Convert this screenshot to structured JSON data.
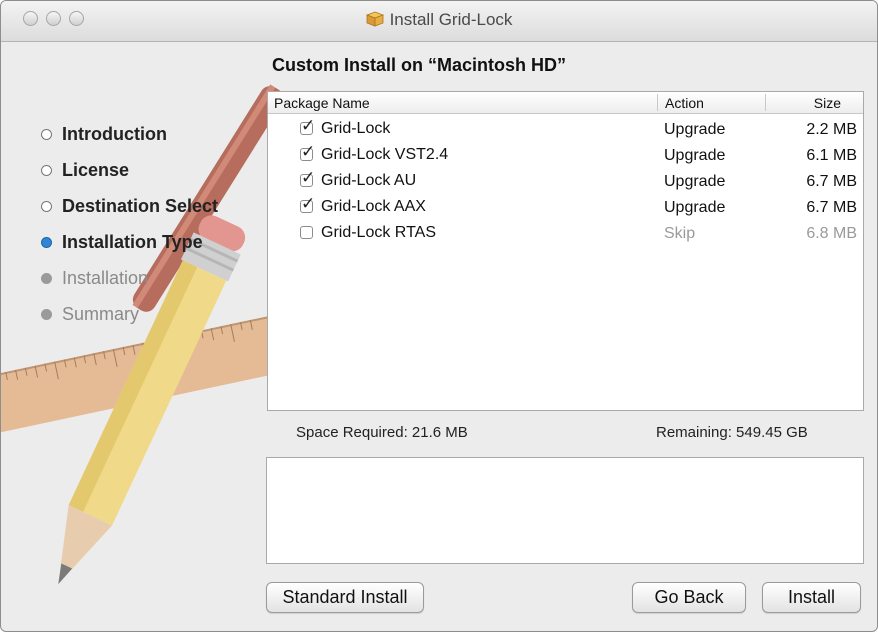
{
  "window": {
    "title": "Install Grid-Lock"
  },
  "sidebar": {
    "steps": [
      {
        "label": "Introduction",
        "state": "done"
      },
      {
        "label": "License",
        "state": "done"
      },
      {
        "label": "Destination Select",
        "state": "done"
      },
      {
        "label": "Installation Type",
        "state": "current"
      },
      {
        "label": "Installation",
        "state": "future"
      },
      {
        "label": "Summary",
        "state": "future"
      }
    ]
  },
  "main": {
    "heading": "Custom Install on “Macintosh HD”",
    "table": {
      "columns": {
        "name": "Package Name",
        "action": "Action",
        "size": "Size"
      },
      "rows": [
        {
          "name": "Grid-Lock",
          "action": "Upgrade",
          "size": "2.2 MB",
          "checked": true
        },
        {
          "name": "Grid-Lock VST2.4",
          "action": "Upgrade",
          "size": "6.1 MB",
          "checked": true
        },
        {
          "name": "Grid-Lock AU",
          "action": "Upgrade",
          "size": "6.7 MB",
          "checked": true
        },
        {
          "name": "Grid-Lock AAX",
          "action": "Upgrade",
          "size": "6.7 MB",
          "checked": true
        },
        {
          "name": "Grid-Lock RTAS",
          "action": "Skip",
          "size": "6.8 MB",
          "checked": false
        }
      ]
    },
    "space_required": "Space Required:  21.6 MB",
    "remaining": "Remaining:  549.45 GB"
  },
  "buttons": {
    "standard": "Standard Install",
    "back": "Go Back",
    "install": "Install"
  },
  "colors": {
    "current_step": "#2f86d6",
    "window_bg": "#ececec"
  },
  "icons": {
    "title": "package-icon",
    "checkbox": "checkmark-icon"
  }
}
